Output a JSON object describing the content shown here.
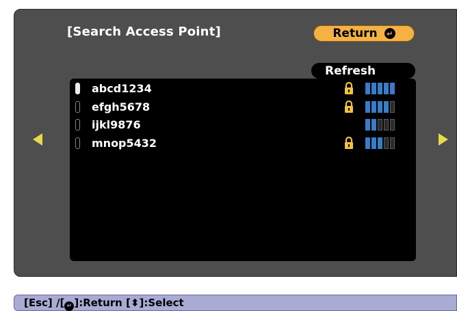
{
  "dialog": {
    "title": "[Search Access Point]",
    "return_label": "Return",
    "refresh_label": "Refresh"
  },
  "access_points": [
    {
      "ssid": "abcd1234",
      "selected": true,
      "locked": true,
      "signal_bars": 5
    },
    {
      "ssid": "efgh5678",
      "selected": false,
      "locked": true,
      "signal_bars": 4
    },
    {
      "ssid": "ijkl9876",
      "selected": false,
      "locked": false,
      "signal_bars": 2
    },
    {
      "ssid": "mnop5432",
      "selected": false,
      "locked": true,
      "signal_bars": 3
    }
  ],
  "signal_bar_max": 5,
  "empty_rows": 6,
  "help": {
    "esc": "[Esc] /[",
    "return_text": "]:Return  [",
    "select_text": "]:Select"
  },
  "colors": {
    "panel": "#4e4e4e",
    "accent_button": "#f4b244",
    "signal_on": "#3a7cc8",
    "nav_arrow": "#e8d94a",
    "help_bar": "#a9abd4"
  },
  "icons": {
    "enter": "enter-icon",
    "lock": "lock-icon",
    "nav_left": "left-arrow-icon",
    "nav_right": "right-arrow-icon",
    "up_down": "up-down-icon"
  }
}
